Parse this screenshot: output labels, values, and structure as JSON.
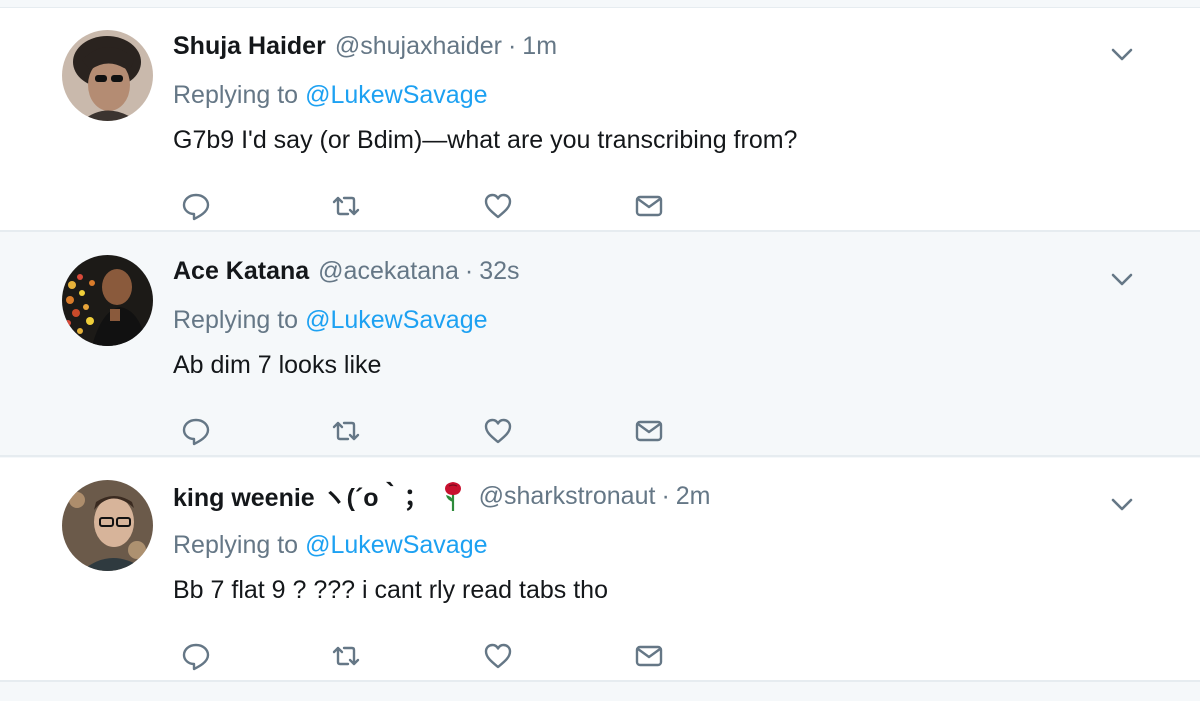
{
  "colors": {
    "name": "#14171a",
    "secondary": "#657786",
    "link": "#1da1f2",
    "divider": "#e6ecf0",
    "highlight_bg": "#f5f8fa"
  },
  "tweets": [
    {
      "name": "Shuja Haider",
      "handle": "@shujaxhaider",
      "separator": "·",
      "time": "1m",
      "replying_label": "Replying to",
      "replying_to": "@LukewSavage",
      "text": "G7b9 I'd say (or Bdim)—what are you transcribing from?",
      "icons": [
        "chevron-down-icon",
        "reply-icon",
        "retweet-icon",
        "like-icon",
        "message-icon"
      ]
    },
    {
      "name": "Ace Katana",
      "handle": "@acekatana",
      "separator": "·",
      "time": "32s",
      "replying_label": "Replying to",
      "replying_to": "@LukewSavage",
      "text": "Ab dim 7 looks like",
      "icons": [
        "chevron-down-icon",
        "reply-icon",
        "retweet-icon",
        "like-icon",
        "message-icon"
      ]
    },
    {
      "name": "king weenie ヽ(´o｀；",
      "name_emoji": "rose-icon",
      "handle": "@sharkstronaut",
      "separator": "·",
      "time": "2m",
      "replying_label": "Replying to",
      "replying_to": "@LukewSavage",
      "text": "Bb 7 flat 9 ? ??? i cant rly read tabs tho",
      "icons": [
        "chevron-down-icon",
        "reply-icon",
        "retweet-icon",
        "like-icon",
        "message-icon"
      ]
    }
  ]
}
